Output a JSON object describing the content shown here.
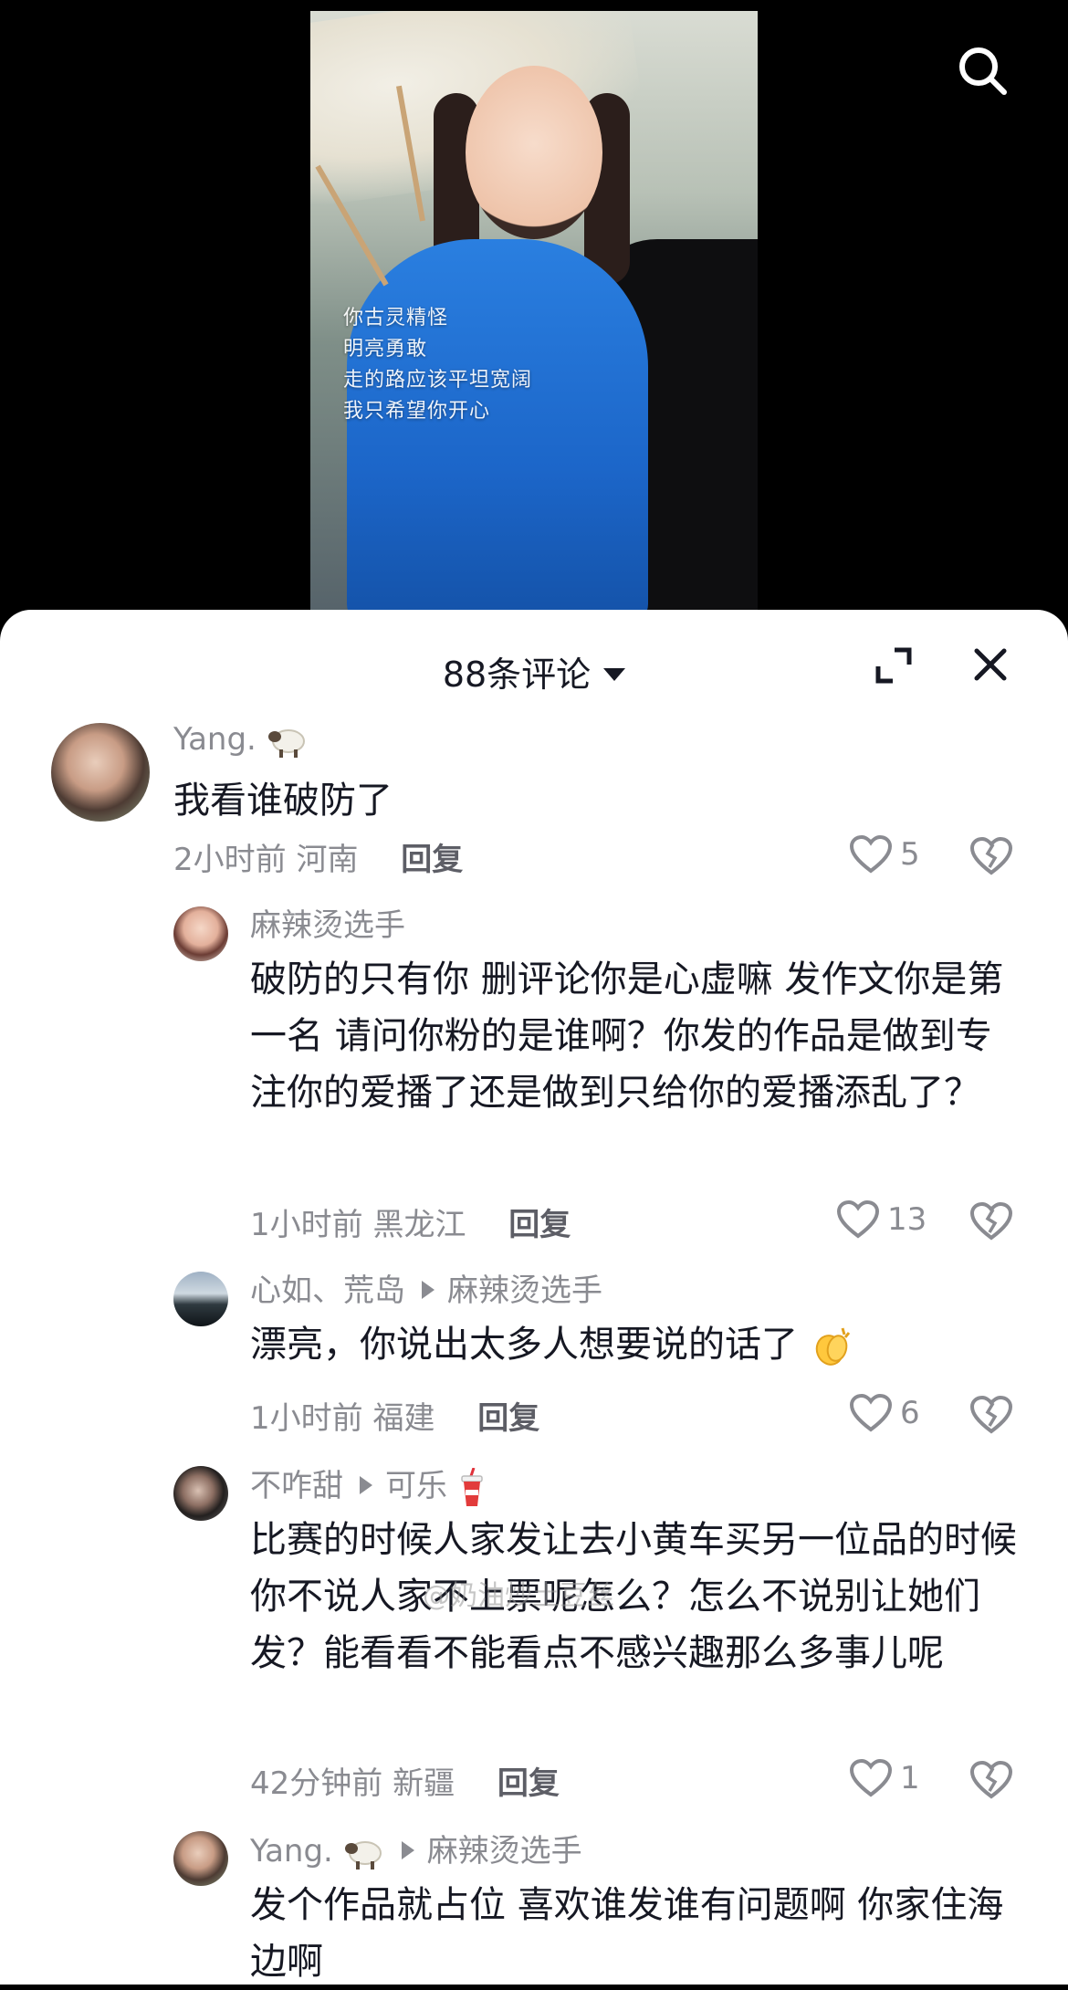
{
  "video": {
    "caption_lines": [
      "你古灵精怪",
      "明亮勇敢",
      "走的路应该平坦宽阔",
      "我只希望你开心"
    ]
  },
  "header": {
    "title": "88条评论"
  },
  "comments": [
    {
      "user": "Yang.",
      "user_emoji": "sheep-emoji",
      "text": "我看谁破防了",
      "time": "2小时前",
      "location": "河南",
      "reply_label": "回复",
      "likes": "5"
    },
    {
      "user": "麻辣烫选手",
      "text": "破防的只有你 删评论你是心虚嘛 发作文你是第一名 请问你粉的是谁啊？你发的作品是做到专注你的爱播了还是做到只给你的爱播添乱了？",
      "time": "1小时前",
      "location": "黑龙江",
      "reply_label": "回复",
      "likes": "13"
    },
    {
      "user": "心如、荒岛",
      "reply_to": "麻辣烫选手",
      "text": "漂亮，你说出太多人想要说的话了",
      "text_emoji": "clapping-hands-emoji",
      "time": "1小时前",
      "location": "福建",
      "reply_label": "回复",
      "likes": "6"
    },
    {
      "user": "不咋甜",
      "reply_to": "可乐",
      "reply_to_emoji": "cola-cup-emoji",
      "text": "比赛的时候人家发让去小黄车买另一位品的时候你不说人家不上票呢怎么？怎么不说别让她们发？能看看不能看点不感兴趣那么多事儿呢",
      "time": "42分钟前",
      "location": "新疆",
      "reply_label": "回复",
      "likes": "1"
    },
    {
      "user": "Yang.",
      "user_emoji": "sheep-emoji",
      "reply_to": "麻辣烫选手",
      "text": "发个作品就占位 喜欢谁发谁有问题啊 你家住海边啊"
    }
  ],
  "watermark": "@奶油炒土豆丝",
  "colors": {
    "text_primary": "#161823",
    "text_secondary": "#8a8b91",
    "sheet_bg": "#ffffff",
    "video_bg": "#000000"
  }
}
